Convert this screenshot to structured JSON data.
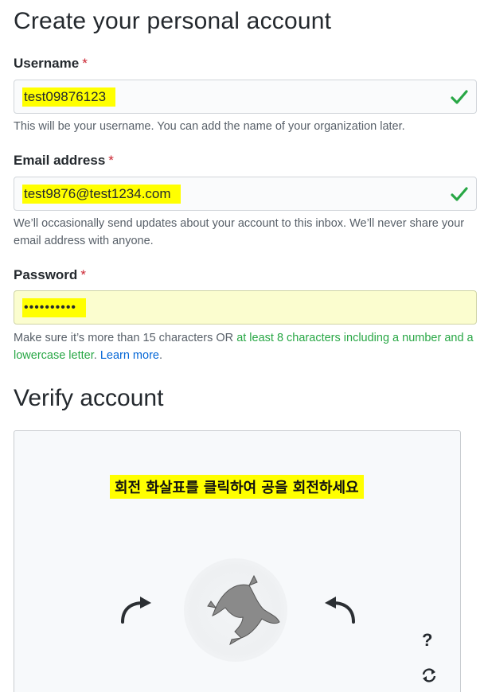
{
  "header": {
    "title": "Create your personal account"
  },
  "form": {
    "required_marker": "*",
    "username": {
      "label": "Username",
      "value": "test09876123",
      "hint": "This will be your username. You can add the name of your organization later."
    },
    "email": {
      "label": "Email address",
      "value": "test9876@test1234.com",
      "hint": "We’ll occasionally send updates about your account to this inbox. We’ll never share your email address with anyone."
    },
    "password": {
      "label": "Password",
      "value": "••••••••••",
      "hint_prefix": "Make sure it’s more than 15 characters OR ",
      "hint_green": "at least 8 characters including a number and a lowercase letter",
      "hint_suffix": ". ",
      "hint_link": "Learn more",
      "hint_end": "."
    }
  },
  "verify": {
    "title": "Verify account",
    "instruction": "회전 화살표를 클릭하여 공을 회전하세요",
    "help_label": "?"
  },
  "colors": {
    "highlight": "#ffff00",
    "check": "#28a745",
    "required": "#cb2431",
    "link": "#0366d6"
  }
}
